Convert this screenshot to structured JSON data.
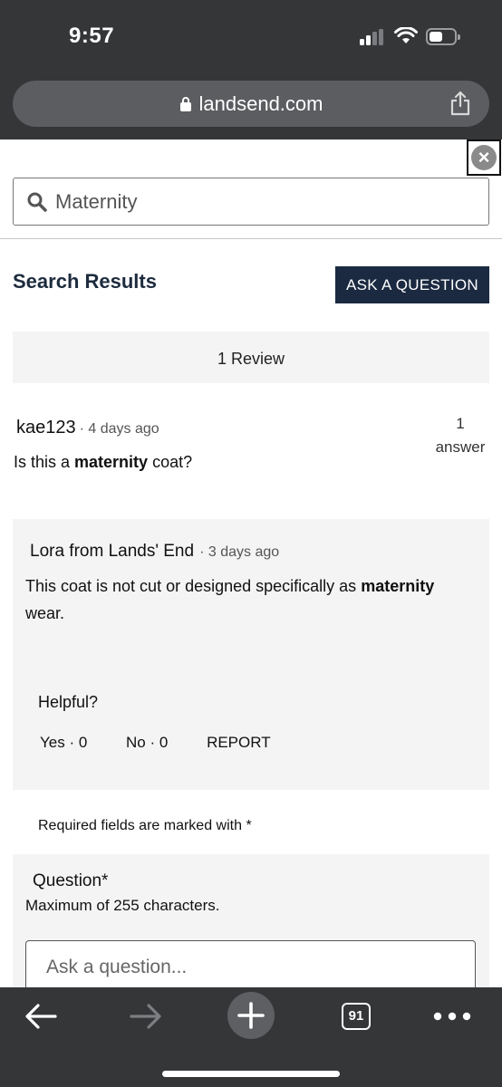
{
  "status_bar": {
    "time": "9:57"
  },
  "browser": {
    "url": "landsend.com",
    "tab_count": "91",
    "icons": {
      "lock": "lock-icon",
      "share": "share-icon",
      "back": "back-arrow-icon",
      "forward": "forward-arrow-icon",
      "new_tab": "plus-icon",
      "tabs": "tabs-icon",
      "more": "more-dots-icon"
    }
  },
  "search": {
    "value": "Maternity",
    "icon": "search-icon"
  },
  "results": {
    "title": "Search Results",
    "ask_button": "ASK A QUESTION",
    "review_count": "1 Review"
  },
  "question": {
    "user": "kae123",
    "date": "· 4 days ago",
    "text_before": "Is this a ",
    "text_bold": "maternity",
    "text_after": " coat?",
    "answer_count_num": "1",
    "answer_count_label": "answer"
  },
  "answer": {
    "user": "Lora from Lands' End",
    "date": "· 3 days ago",
    "text_before": "This coat is not cut or designed specifically as ",
    "text_bold": "maternity",
    "text_after": " wear.",
    "helpful_label": "Helpful?",
    "yes": "Yes · 0",
    "no": "No · 0",
    "report": "REPORT"
  },
  "form": {
    "required_note": "Required fields are marked with *",
    "question_label": "Question*",
    "max_chars": "Maximum of 255 characters.",
    "placeholder": "Ask a question..."
  },
  "colors": {
    "chrome": "#343638",
    "navy": "#1b2a41",
    "panel": "#f4f4f4"
  }
}
